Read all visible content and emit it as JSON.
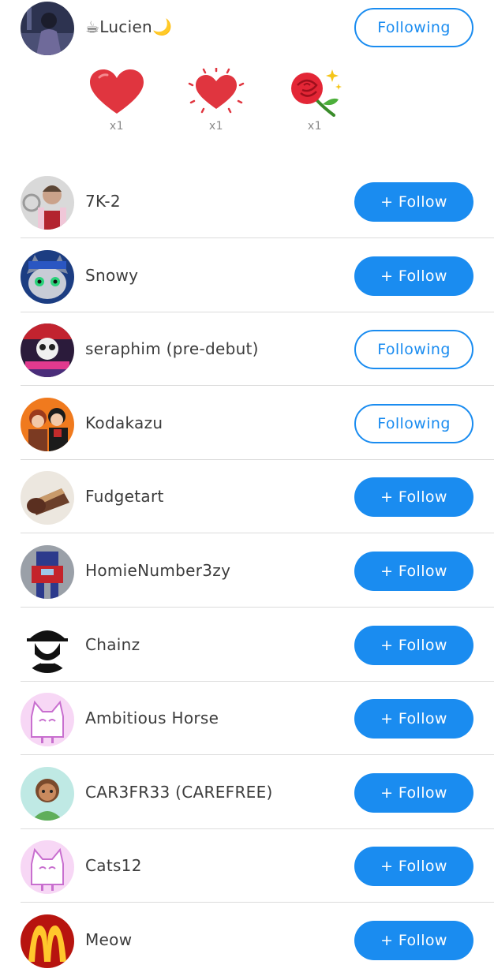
{
  "header_user": {
    "name": "☕Lucien🌙",
    "button_label": "Following"
  },
  "gifts": [
    {
      "icon": "heart-icon",
      "count": "x1"
    },
    {
      "icon": "sparkling-heart-icon",
      "count": "x1"
    },
    {
      "icon": "rose-icon",
      "count": "x1"
    }
  ],
  "users": [
    {
      "name": "7K-2",
      "button_label": "+ Follow",
      "state": "follow"
    },
    {
      "name": "Snowy",
      "button_label": "+ Follow",
      "state": "follow"
    },
    {
      "name": "seraphim (pre-debut)",
      "button_label": "Following",
      "state": "following"
    },
    {
      "name": "Kodakazu",
      "button_label": "Following",
      "state": "following"
    },
    {
      "name": "Fudgetart",
      "button_label": "+ Follow",
      "state": "follow"
    },
    {
      "name": "HomieNumber3zy",
      "button_label": "+ Follow",
      "state": "follow"
    },
    {
      "name": "Chainz",
      "button_label": "+ Follow",
      "state": "follow"
    },
    {
      "name": "Ambitious Horse",
      "button_label": "+ Follow",
      "state": "follow"
    },
    {
      "name": "CAR3FR33 (CAREFREE)",
      "button_label": "+ Follow",
      "state": "follow"
    },
    {
      "name": "Cats12",
      "button_label": "+ Follow",
      "state": "follow"
    },
    {
      "name": "Meow",
      "button_label": "+ Follow",
      "state": "follow"
    }
  ],
  "colors": {
    "accent": "#1a8cf0",
    "text": "#3c3c3c",
    "divider": "#dcdcdc"
  }
}
